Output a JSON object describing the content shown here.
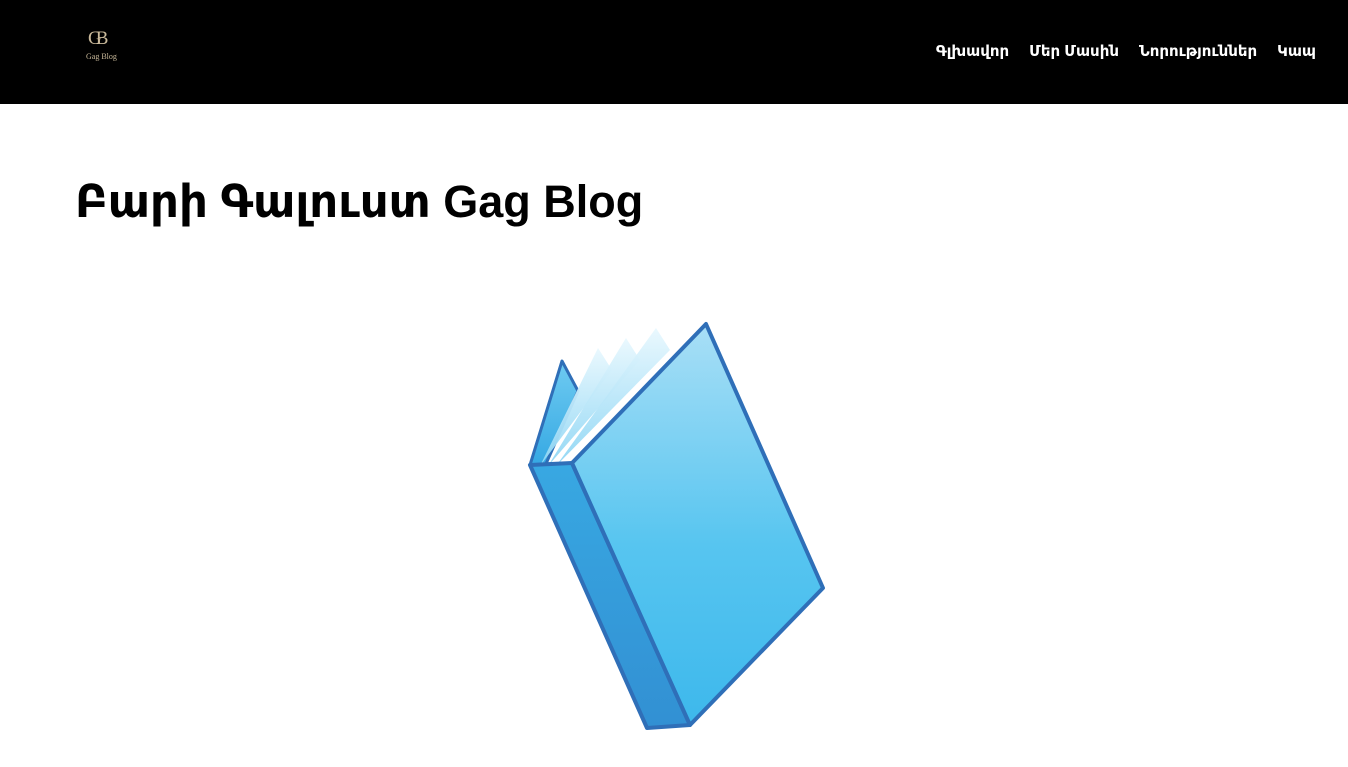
{
  "header": {
    "logo": {
      "mark": "GB",
      "text": "Gag Blog"
    },
    "nav": [
      {
        "label": "Գլխավոր"
      },
      {
        "label": "Մեր Մասին"
      },
      {
        "label": "Նորություններ"
      },
      {
        "label": "Կապ"
      }
    ]
  },
  "main": {
    "title": "Բարի Գալուստ Gag Blog",
    "hero_image": {
      "icon": "book-icon"
    }
  },
  "colors": {
    "header_bg": "#000000",
    "nav_text": "#ffffff",
    "logo": "#c9b99a",
    "book_blue": "#4fc1ef",
    "book_outline": "#2f6fb8"
  }
}
